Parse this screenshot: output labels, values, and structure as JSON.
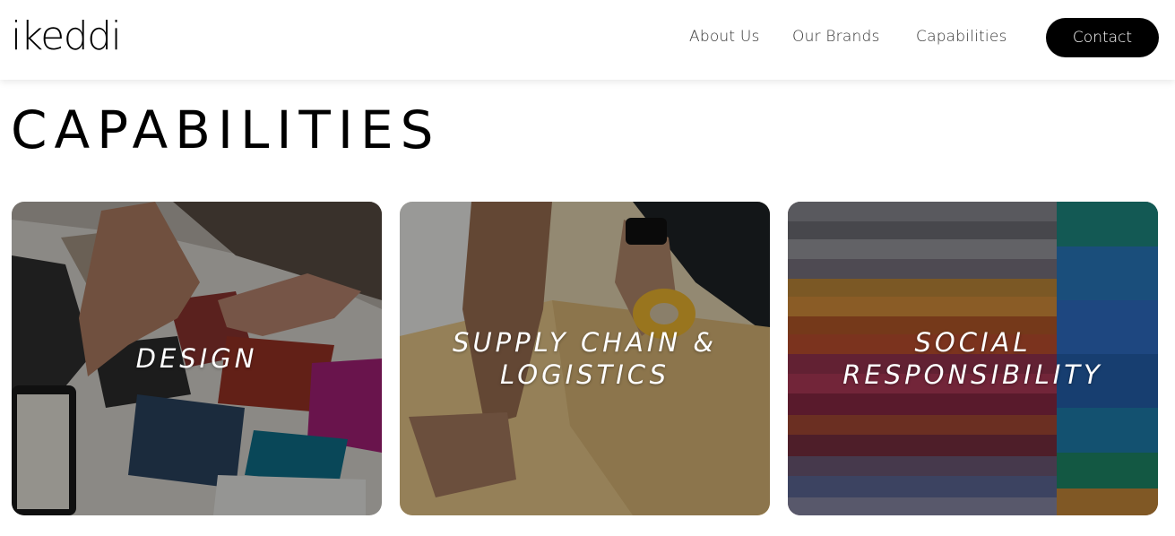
{
  "header": {
    "logo": "ikeddi",
    "nav": [
      "About Us",
      "Our Brands",
      "Capabilities"
    ],
    "contact": "Contact"
  },
  "page": {
    "title": "CAPABILITIES"
  },
  "cards": [
    {
      "label_lines": [
        "DESIGN"
      ]
    },
    {
      "label_lines": [
        "SUPPLY CHAIN &",
        "LOGISTICS"
      ]
    },
    {
      "label_lines": [
        "SOCIAL",
        "RESPONSIBILITY"
      ]
    }
  ]
}
